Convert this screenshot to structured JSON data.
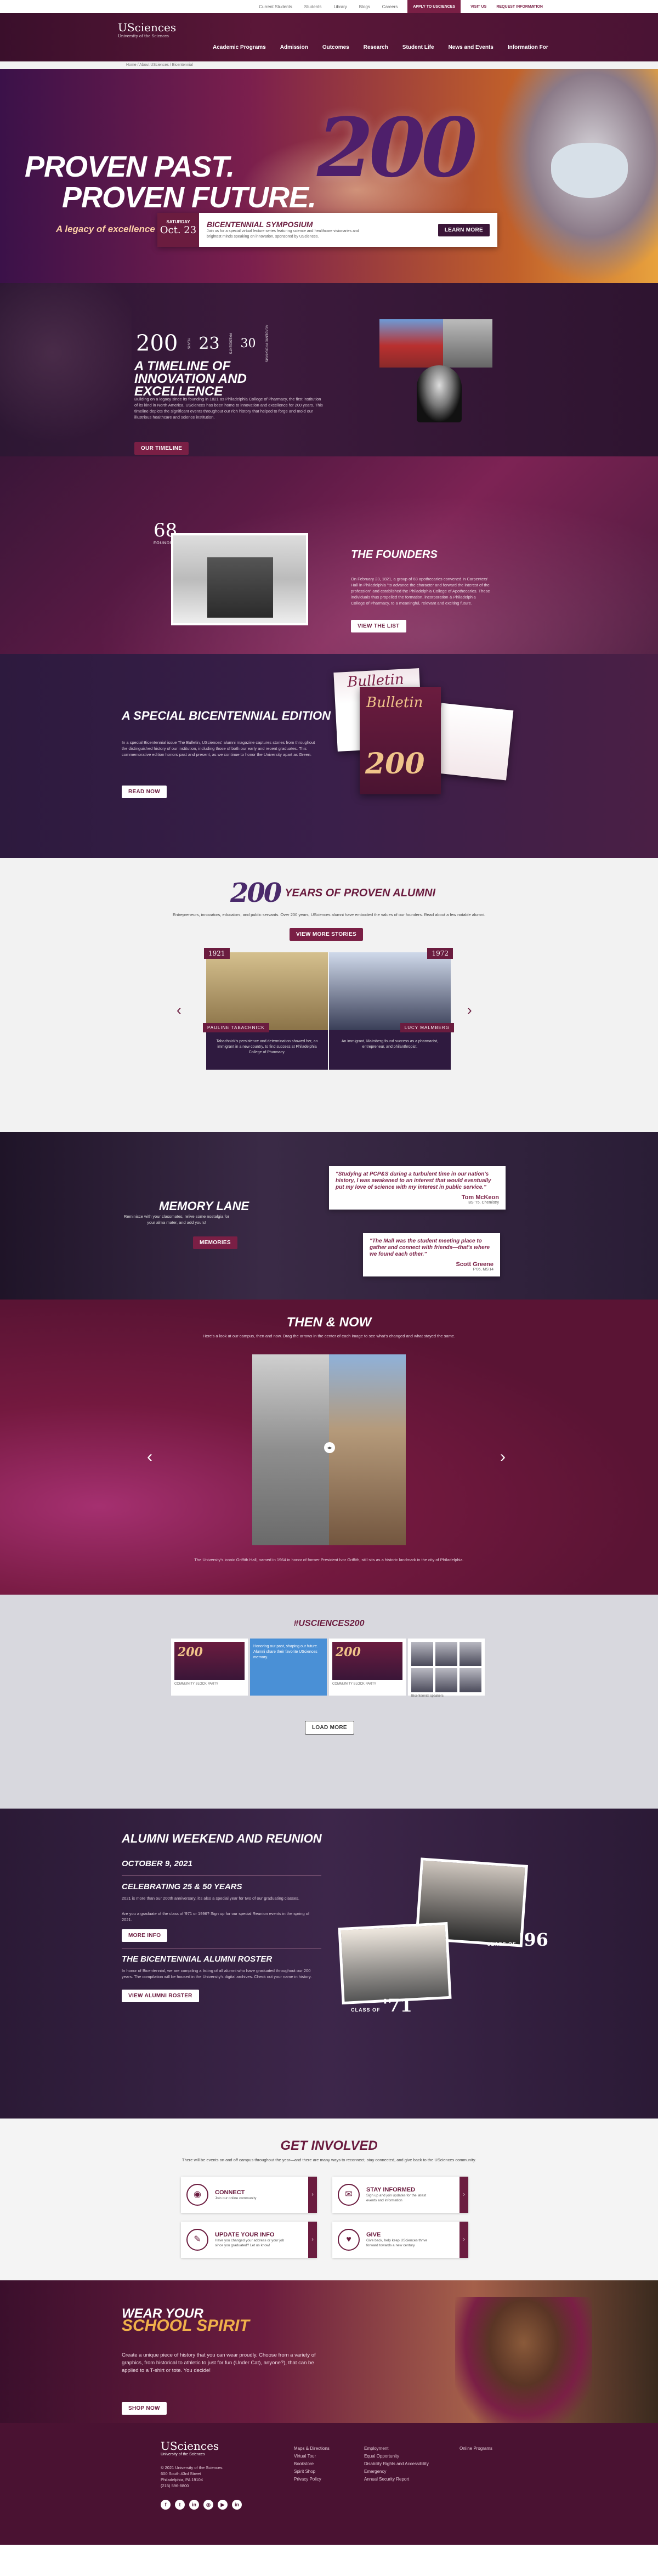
{
  "utility": {
    "links": [
      "Current Students",
      "Students",
      "Library",
      "Blogs",
      "Careers"
    ],
    "apply": "APPLY TO USCIENCES",
    "visit": "VISIT US",
    "request": "REQUEST INFORMATION"
  },
  "header": {
    "logo_main": "USciences",
    "logo_sub": "University of the Sciences",
    "nav": [
      "Academic Programs",
      "Admission",
      "Outcomes",
      "Research",
      "Student Life",
      "News and Events",
      "Information For"
    ]
  },
  "breadcrumb": "Home  /  About USciences  /  Bicentennial",
  "hero": {
    "line1": "PROVEN PAST.",
    "line2": "PROVEN FUTURE.",
    "big": "200",
    "tagline": "A legacy of excellence in healthcare and science education."
  },
  "event": {
    "day": "SATURDAY",
    "date": "Oct. 23",
    "title": "BICENTENNIAL SYMPOSIUM",
    "text": "Join us for a special virtual lecture series featuring science and healthcare visionaries and brightest minds speaking on innovation, sponsored by USciences.",
    "cta": "LEARN MORE"
  },
  "timeline": {
    "n1": "200",
    "n1_label": "YEARS",
    "n2": "23",
    "n2_label": "PRESIDENTS",
    "n3": "30",
    "n3_label": "ACADEMIC PROGRAMS",
    "title": "A TIMELINE OF INNOVATION AND EXCELLENCE",
    "text": "Building on a legacy since its founding in 1821 as Philadelphia College of Pharmacy, the first institution of its kind in North America, USciences has been home to innovation and excellence for 200 years. This timeline depicts the significant events throughout our rich history that helped to forge and mold our illustrious healthcare and science institution.",
    "cta": "OUR TIMELINE"
  },
  "founders": {
    "num": "68",
    "num_label": "FOUNDERS",
    "title": "THE FOUNDERS",
    "text": "On February 23, 1821, a group of 68 apothecaries convened in Carpenters' Hall in Philadelphia \"to advance the character and forward the interest of the profession\" and established the Philadelphia College of Apothecaries. These individuals thus propelled the formation, incorporation & Philadelphia College of Pharmacy, to a meaningful, relevant and exciting future.",
    "cta": "VIEW THE LIST"
  },
  "bulletin": {
    "title": "A SPECIAL BICENTENNIAL EDITION",
    "text": "In a special Bicentennial issue The Bulletin, USciences' alumni magazine captures stories from throughout the distinguished history of our institution, including those of both our early and recent graduates. This commemorative edition honors past and present, as we continue to honor the University apart as Green.",
    "cta": "READ NOW",
    "mag_title": "Bulletin",
    "mag_num": "200"
  },
  "alumni": {
    "num": "200",
    "title": "YEARS OF PROVEN ALUMNI",
    "intro": "Entrepreneurs, innovators, educators, and public servants. Over 200 years, USciences alumni have embodied the values of our founders. Read about a few notable alumni.",
    "cta": "VIEW MORE STORIES",
    "cards": [
      {
        "year": "1921",
        "name": "PAULINE TABACHNICK",
        "quote": "Tabachnick's persistence and determination showed her, an immigrant in a new country, to find success at Philadelphia College of Pharmacy."
      },
      {
        "year": "1972",
        "name": "LUCY MALMBERG",
        "quote": "An immigrant, Malmberg found success as a pharmacist, entrepreneur, and philanthropist."
      }
    ],
    "prev": "‹",
    "next": "›"
  },
  "memory": {
    "title": "MEMORY LANE",
    "text": "Reminisce with your classmates, relive some nostalgia for your alma mater, and add yours!",
    "cta": "MEMORIES",
    "quotes": [
      {
        "q": "\"Studying at PCP&S during a turbulent time in our nation's history, I was awakened to an interest that would eventually put my love of science with my interest in public service.\"",
        "who": "Tom McKeon",
        "cls": "BS '75, Chemistry"
      },
      {
        "q": "\"The Mall was the student meeting place to gather and connect with friends—that's where we found each other.\"",
        "who": "Scott Greene",
        "cls": "P'06, MS'14"
      }
    ]
  },
  "thennow": {
    "title": "THEN & NOW",
    "intro": "Here's a look at our campus, then and now. Drag the arrows in the center of each image to see what's changed and what stayed the same.",
    "caption": "The University's iconic Griffith Hall, named in 1964 in honor of former President Ivor Griffith, still sits as a historic landmark in the city of Philadelphia.",
    "prev": "‹",
    "next": "›",
    "handle": "◂▸"
  },
  "social": {
    "hashtag": "#USCIENCES200",
    "tiles": [
      {
        "num": "200",
        "cap": "COMMUNITY BLOCK PARTY"
      },
      {
        "num": "",
        "cap": "Honoring our past, shaping our future. Alumni share their favorite USciences memory."
      },
      {
        "num": "200",
        "cap": "COMMUNITY BLOCK PARTY"
      },
      {
        "num": "",
        "cap": "Bicentennial speakers"
      }
    ],
    "cta": "LOAD MORE"
  },
  "reunion": {
    "title": "ALUMNI WEEKEND AND REUNION",
    "date": "OCTOBER 9, 2021",
    "sub1": "CELEBRATING 25 & 50 YEARS",
    "text1": "2021 is more than our 200th anniversary, it's also a special year for two of our graduating classes.",
    "text1b": "Are you a graduate of the class of '971 or 1996? Sign up for our special Reunion events in the spring of 2021.",
    "cta1": "MORE INFO",
    "sub2": "THE BICENTENNIAL ALUMNI ROSTER",
    "text2": "In honor of Bicentennial, we are compiling a listing of all alumni who have graduated throughout our 200 years. The compilation will be housed in the University's digital archives. Check out your name in history.",
    "cta2": "VIEW ALUMNI ROSTER",
    "class_label": "CLASS OF",
    "c96": "'96",
    "c71": "'71"
  },
  "involved": {
    "title": "GET INVOLVED",
    "intro": "There will be events on and off campus throughout the year—and there are many ways to reconnect, stay connected, and give back to the USciences community.",
    "boxes": [
      {
        "title": "CONNECT",
        "text": "Join our online community",
        "icon": "◉"
      },
      {
        "title": "STAY INFORMED",
        "text": "Sign up and join updates for the latest events and information",
        "icon": "✉"
      },
      {
        "title": "UPDATE YOUR INFO",
        "text": "Have you changed your address or your job since you graduated? Let us know!",
        "icon": "✎"
      },
      {
        "title": "GIVE",
        "text": "Give back, help keep USciences thrive forward towards a new century",
        "icon": "♥"
      }
    ]
  },
  "spirit": {
    "line1": "WEAR YOUR",
    "line2": "SCHOOL SPIRIT",
    "text": "Create a unique piece of history that you can wear proudly. Choose from a variety of graphics, from historical to athletic to just for fun (Under Cat), anyone?), that can be applied to a T-shirt or tote. You decide!",
    "cta": "SHOP NOW"
  },
  "footer": {
    "logo": "USciences",
    "logo_sub": "University of the Sciences",
    "address": [
      "© 2021 University of the Sciences",
      "600 South 43rd Street",
      "Philadelphia, PA 19104",
      "(215) 596-8800"
    ],
    "socials": [
      "f",
      "t",
      "in",
      "◎",
      "▶",
      "in"
    ],
    "col1": [
      "Maps & Directions",
      "Virtual Tour",
      "Bookstore",
      "Spirit Shop",
      "Privacy Policy"
    ],
    "col2": [
      "Employment",
      "Equal Opportunity",
      "Disability Rights and Accessibility",
      "Emergency",
      "Annual Security Report"
    ],
    "col3": [
      "Online Programs"
    ]
  },
  "colors": {
    "maroon": "#6b1c3f",
    "purple": "#4a2a6b",
    "gold": "#f0b04a"
  }
}
